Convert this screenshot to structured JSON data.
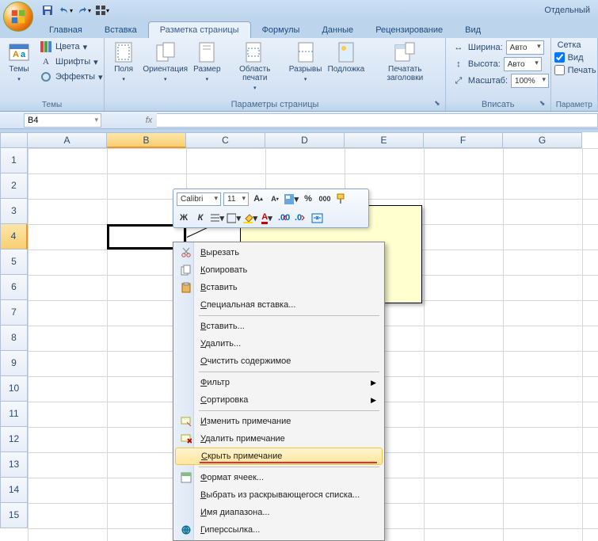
{
  "title_right": "Отдельный",
  "qat": {
    "save": "save",
    "undo": "undo",
    "redo": "redo"
  },
  "tabs": [
    "Главная",
    "Вставка",
    "Разметка страницы",
    "Формулы",
    "Данные",
    "Рецензирование",
    "Вид"
  ],
  "active_tab": 2,
  "ribbon": {
    "themes": {
      "btn": "Темы",
      "colors": "Цвета",
      "fonts": "Шрифты",
      "effects": "Эффекты",
      "label": "Темы"
    },
    "page_setup": {
      "margins": "Поля",
      "orientation": "Ориентация",
      "size": "Размер",
      "print_area": "Область печати",
      "breaks": "Разрывы",
      "background": "Подложка",
      "print_titles": "Печатать заголовки",
      "label": "Параметры страницы"
    },
    "fit": {
      "width": "Ширина:",
      "height": "Высота:",
      "scale": "Масштаб:",
      "w_val": "Авто",
      "h_val": "Авто",
      "s_val": "100%",
      "label": "Вписать"
    },
    "sheet_opts": {
      "grid": "Сетка",
      "view": "Вид",
      "print": "Печать",
      "label": "Параметр"
    }
  },
  "namebox": "B4",
  "columns": [
    "A",
    "B",
    "C",
    "D",
    "E",
    "F",
    "G"
  ],
  "rows": [
    "1",
    "2",
    "3",
    "4",
    "5",
    "6",
    "7",
    "8",
    "9",
    "10",
    "11",
    "12",
    "13",
    "14",
    "15"
  ],
  "mini": {
    "font": "Calibri",
    "size": "11"
  },
  "ctx": [
    {
      "k": "cut",
      "t": "Вырезать",
      "ico": "cut"
    },
    {
      "k": "copy",
      "t": "Копировать",
      "ico": "copy"
    },
    {
      "k": "paste",
      "t": "Вставить",
      "ico": "paste"
    },
    {
      "k": "paste_special",
      "t": "Специальная вставка..."
    },
    {
      "sep": true
    },
    {
      "k": "insert",
      "t": "Вставить..."
    },
    {
      "k": "delete",
      "t": "Удалить..."
    },
    {
      "k": "clear",
      "t": "Очистить содержимое"
    },
    {
      "sep": true
    },
    {
      "k": "filter",
      "t": "Фильтр",
      "sub": true
    },
    {
      "k": "sort",
      "t": "Сортировка",
      "sub": true
    },
    {
      "sep": true
    },
    {
      "k": "edit_comment",
      "t": "Изменить примечание",
      "ico": "editc"
    },
    {
      "k": "delete_comment",
      "t": "Удалить примечание",
      "ico": "delc"
    },
    {
      "k": "hide_comment",
      "t": "Скрыть примечание",
      "hl": true
    },
    {
      "sep": true
    },
    {
      "k": "format_cells",
      "t": "Формат ячеек...",
      "ico": "fmt"
    },
    {
      "k": "pick_list",
      "t": "Выбрать из раскрывающегося списка..."
    },
    {
      "k": "name_range",
      "t": "Имя диапазона..."
    },
    {
      "k": "hyperlink",
      "t": "Гиперссылка...",
      "ico": "link"
    }
  ]
}
